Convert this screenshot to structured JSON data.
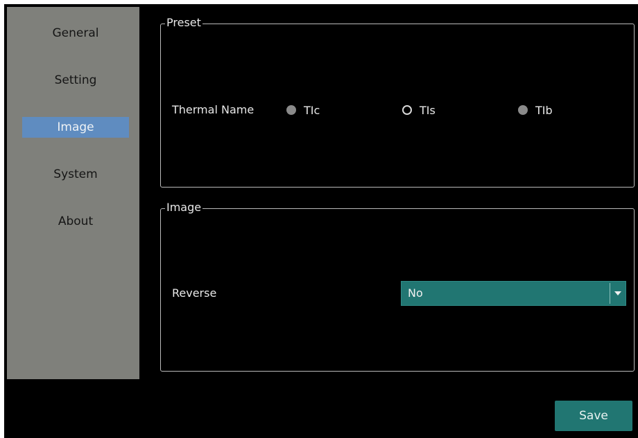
{
  "sidebar": {
    "items": [
      {
        "label": "General"
      },
      {
        "label": "Setting"
      },
      {
        "label": "Image",
        "active": true
      },
      {
        "label": "System"
      },
      {
        "label": "About"
      }
    ]
  },
  "preset": {
    "title": "Preset",
    "thermal_label": "Thermal Name",
    "options": [
      {
        "label": "TIc",
        "selected": false
      },
      {
        "label": "TIs",
        "selected": true
      },
      {
        "label": "TIb",
        "selected": false
      }
    ]
  },
  "image": {
    "title": "Image",
    "reverse_label": "Reverse",
    "reverse_value": "No"
  },
  "footer": {
    "save_label": "Save"
  },
  "colors": {
    "sidebar_bg": "#7f807b",
    "sidebar_active": "#5f8cc0",
    "accent_teal": "#217672",
    "background": "#000000"
  }
}
